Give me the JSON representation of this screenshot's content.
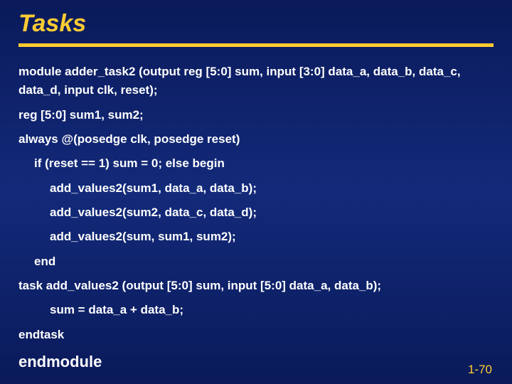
{
  "title": "Tasks",
  "code": {
    "l1": "module adder_task2 (output  reg [5:0] sum, input [3:0] data_a, data_b, data_c, data_d, input clk, reset);",
    "l2": "reg [5:0] sum1, sum2;",
    "l3": "always @(posedge clk, posedge reset)",
    "l4": "if (reset == 1) sum = 0; else begin",
    "l5": "add_values2(sum1, data_a, data_b);",
    "l6": "add_values2(sum2, data_c, data_d);",
    "l7": "add_values2(sum, sum1, sum2);",
    "l8": "end",
    "l9": "task add_values2 (output [5:0] sum, input [5:0] data_a, data_b);",
    "l10": "sum = data_a + data_b;",
    "l11": "endtask",
    "l12": "endmodule"
  },
  "pagenum": "1-70"
}
